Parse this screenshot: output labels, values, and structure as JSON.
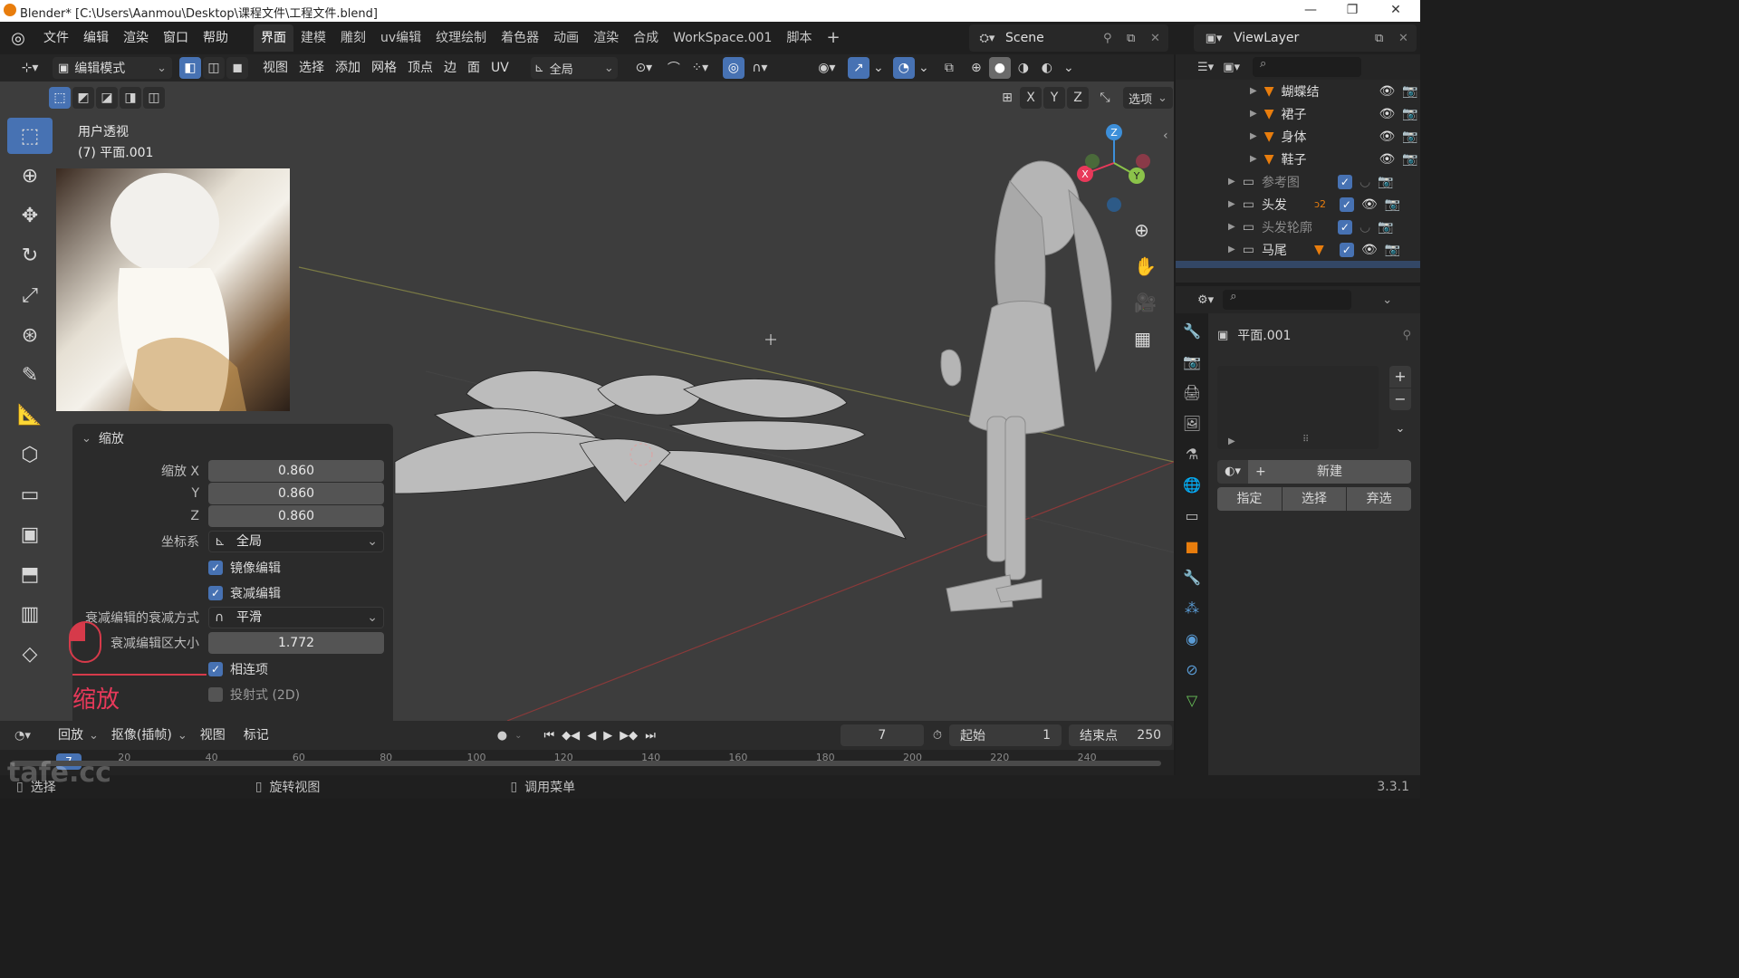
{
  "window": {
    "title": "Blender* [C:\\Users\\Aanmou\\Desktop\\课程文件\\工程文件.blend]",
    "controls": [
      "—",
      "❐",
      "✕"
    ]
  },
  "menu": {
    "items": [
      "文件",
      "编辑",
      "渲染",
      "窗口",
      "帮助"
    ],
    "workspaces": [
      "界面",
      "建模",
      "雕刻",
      "uv编辑",
      "纹理绘制",
      "着色器",
      "动画",
      "渲染",
      "合成",
      "WorkSpace.001",
      "脚本"
    ],
    "add_tab": "+",
    "scene_name": "Scene",
    "viewlayer_name": "ViewLayer"
  },
  "header": {
    "mode": "编辑模式",
    "menus": [
      "视图",
      "选择",
      "添加",
      "网格",
      "顶点",
      "边",
      "面",
      "UV"
    ],
    "transform_orientation": "全局",
    "axes": [
      "X",
      "Y",
      "Z"
    ],
    "options": "选项"
  },
  "viewport": {
    "view_name": "用户透视",
    "object_info": "(7) 平面.001",
    "gizmo_axes": {
      "x": "X",
      "y": "Y",
      "z": "Z"
    }
  },
  "operator_panel": {
    "title": "缩放",
    "scale_x_label": "缩放 X",
    "scale_x": "0.860",
    "scale_y_label": "Y",
    "scale_y": "0.860",
    "scale_z_label": "Z",
    "scale_z": "0.860",
    "orient_label": "坐标系",
    "orient_value": "全局",
    "mirror_label": "镜像编辑",
    "mirror_checked": true,
    "proportional_label": "衰减编辑",
    "proportional_checked": true,
    "falloff_label": "衰减编辑的衰减方式",
    "falloff_value": "平滑",
    "size_label": "衰减编辑区大小",
    "size_value": "1.772",
    "connected_label": "相连项",
    "connected_checked": true,
    "projected_label": "投射式 (2D)",
    "projected_checked": false,
    "overlay_caption": "缩放"
  },
  "outliner": {
    "items": [
      {
        "label": "蝴蝶结",
        "type": "mesh"
      },
      {
        "label": "裙子",
        "type": "mesh"
      },
      {
        "label": "身体",
        "type": "mesh"
      },
      {
        "label": "鞋子",
        "type": "mesh"
      },
      {
        "label": "参考图",
        "type": "collection"
      },
      {
        "label": "头发",
        "type": "collection"
      },
      {
        "label": "头发轮廓",
        "type": "collection"
      },
      {
        "label": "马尾",
        "type": "collection"
      }
    ],
    "badge_hair": "2"
  },
  "properties": {
    "object_name": "平面.001",
    "new_label": "新建",
    "assign_label": "指定",
    "select_label": "选择",
    "deselect_label": "弃选",
    "add_icon": "+",
    "remove_icon": "−"
  },
  "timeline": {
    "playback": "回放",
    "keying": "抠像(插帧)",
    "view": "视图",
    "marker": "标记",
    "current_frame": "7",
    "start_label": "起始",
    "start_value": "1",
    "end_label": "结束点",
    "end_value": "250",
    "ruler": [
      "0",
      "20",
      "40",
      "60",
      "80",
      "100",
      "120",
      "140",
      "160",
      "180",
      "200",
      "220",
      "240"
    ]
  },
  "statusbar": {
    "left": "选择",
    "middle": "旋转视图",
    "right": "调用菜单",
    "version": "3.3.1",
    "watermark": "tafe.cc"
  },
  "colors": {
    "accent": "#4772b3",
    "x_axis": "#e8395a",
    "y_axis": "#8bc34a",
    "z_axis": "#3d8fd9",
    "mesh_orange": "#e87d0d"
  }
}
